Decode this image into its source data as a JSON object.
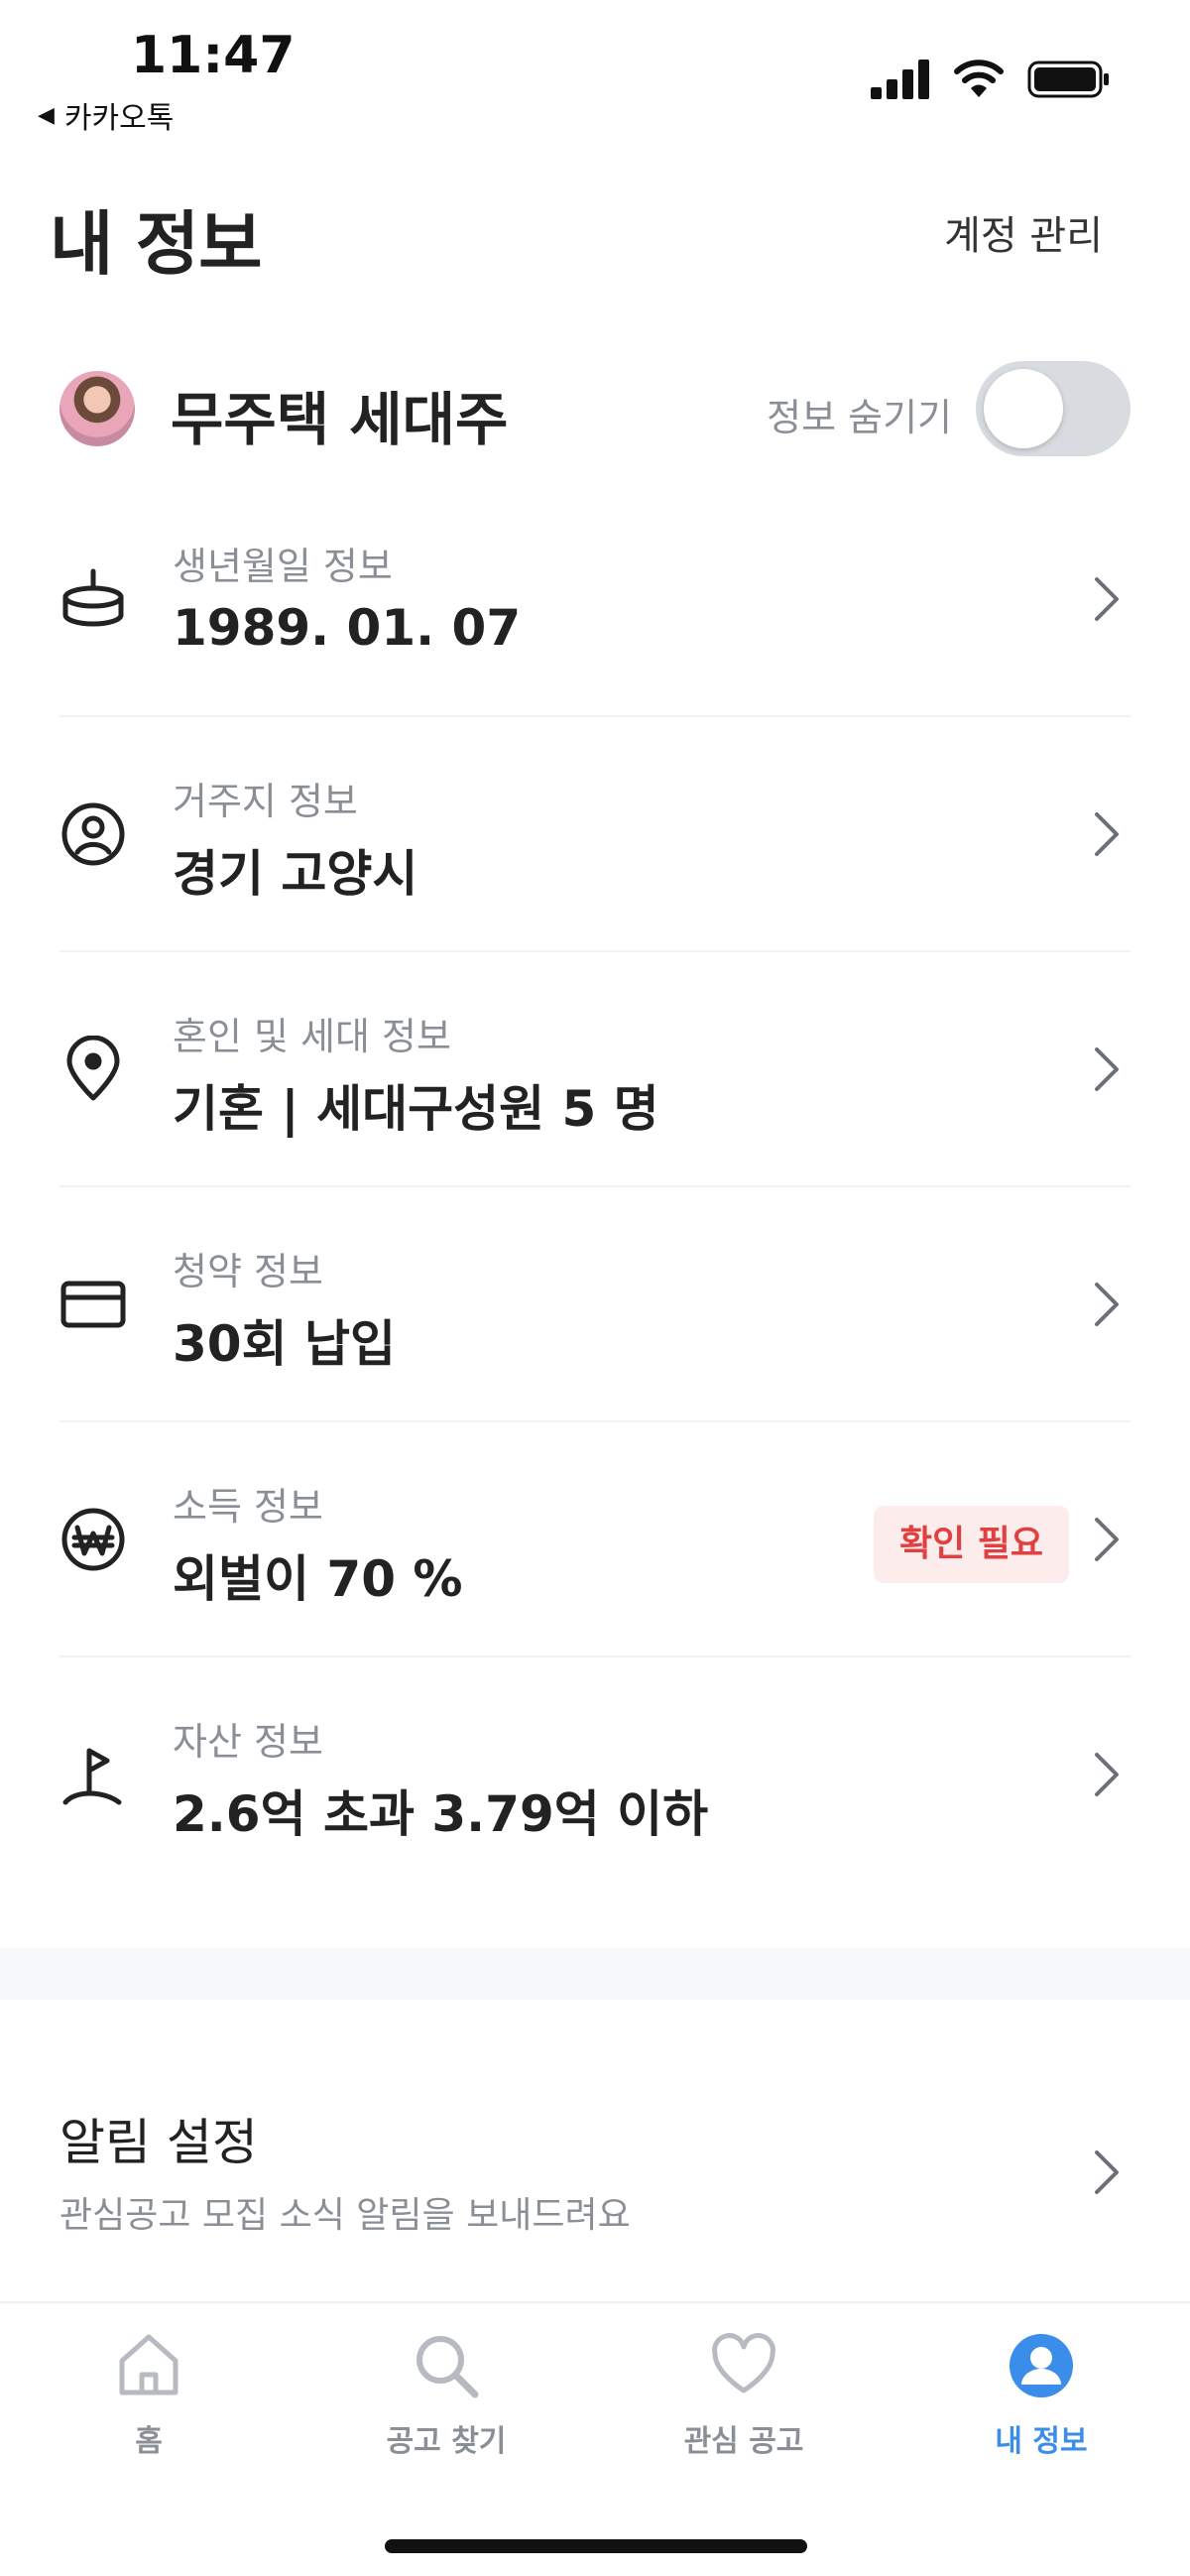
{
  "status_bar": {
    "time": "11:47",
    "back_app": "카카오톡",
    "back_icon": "back-triangle-icon"
  },
  "header": {
    "title": "내 정보",
    "account_link": "계정 관리"
  },
  "profile": {
    "name": "무주택 세대주",
    "hide_label": "정보 숨기기",
    "hide_toggle_on": false
  },
  "info_items": [
    {
      "label": "생년월일 정보",
      "value": "1989. 01. 07",
      "icon": "cake-icon"
    },
    {
      "label": "거주지 정보",
      "value": "경기 고양시",
      "icon": "person-circle-icon"
    },
    {
      "label": "혼인 및 세대 정보",
      "value": "기혼 | 세대구성원 5 명",
      "icon": "location-pin-icon"
    },
    {
      "label": "청약 정보",
      "value": "30회 납입",
      "icon": "card-icon"
    },
    {
      "label": "소득 정보",
      "value": "외벌이 70 %",
      "icon": "won-coin-icon",
      "badge": "확인 필요"
    },
    {
      "label": "자산 정보",
      "value": "2.6억 초과 3.79억 이하",
      "icon": "flag-icon"
    }
  ],
  "notification": {
    "title": "알림 설정",
    "subtitle": "관심공고 모집 소식 알림을 보내드려요"
  },
  "tabs": [
    {
      "label": "홈",
      "icon": "home-icon",
      "active": false
    },
    {
      "label": "공고 찾기",
      "icon": "search-icon",
      "active": false
    },
    {
      "label": "관심 공고",
      "icon": "heart-icon",
      "active": false
    },
    {
      "label": "내 정보",
      "icon": "user-circle-icon",
      "active": true
    }
  ],
  "colors": {
    "accent": "#3a8de8",
    "badge_text": "#e04040",
    "badge_bg": "#fdecec",
    "muted_text": "#8a8f96"
  }
}
